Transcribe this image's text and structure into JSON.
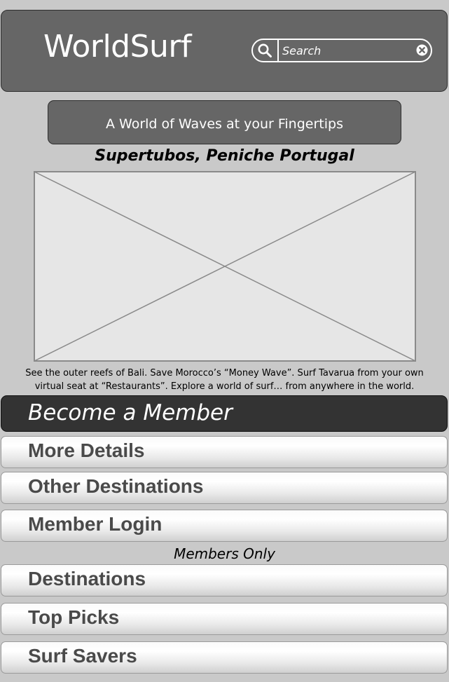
{
  "header": {
    "title": "WorldSurf",
    "search": {
      "placeholder": "Search",
      "value": ""
    }
  },
  "tagline": "A World of Waves at your Fingertips",
  "featured": {
    "location": "Supertubos, Peniche Portugal",
    "description_line1": "See the outer reefs of Bali. Save Morocco’s “Money Wave”. Surf Tavarua from your own",
    "description_line2": "virtual seat at “Restaurants”. Explore a world of surf… from anywhere in the world."
  },
  "cta_label": "Become a Member",
  "nav": [
    {
      "label": "More Details"
    },
    {
      "label": "Other Destinations"
    },
    {
      "label": "Member Login"
    }
  ],
  "members_only_label": "Members Only",
  "member_nav": [
    {
      "label": "Destinations"
    },
    {
      "label": "Top Picks"
    },
    {
      "label": "Surf Savers"
    }
  ],
  "icons": {
    "search": "search-icon",
    "clear": "close-circle-icon",
    "image_placeholder": "image-placeholder-icon"
  },
  "colors": {
    "header_bg": "#666666",
    "cta_bg": "#333333",
    "page_bg": "#c9c9c9",
    "nav_text": "#4a4a4a"
  }
}
